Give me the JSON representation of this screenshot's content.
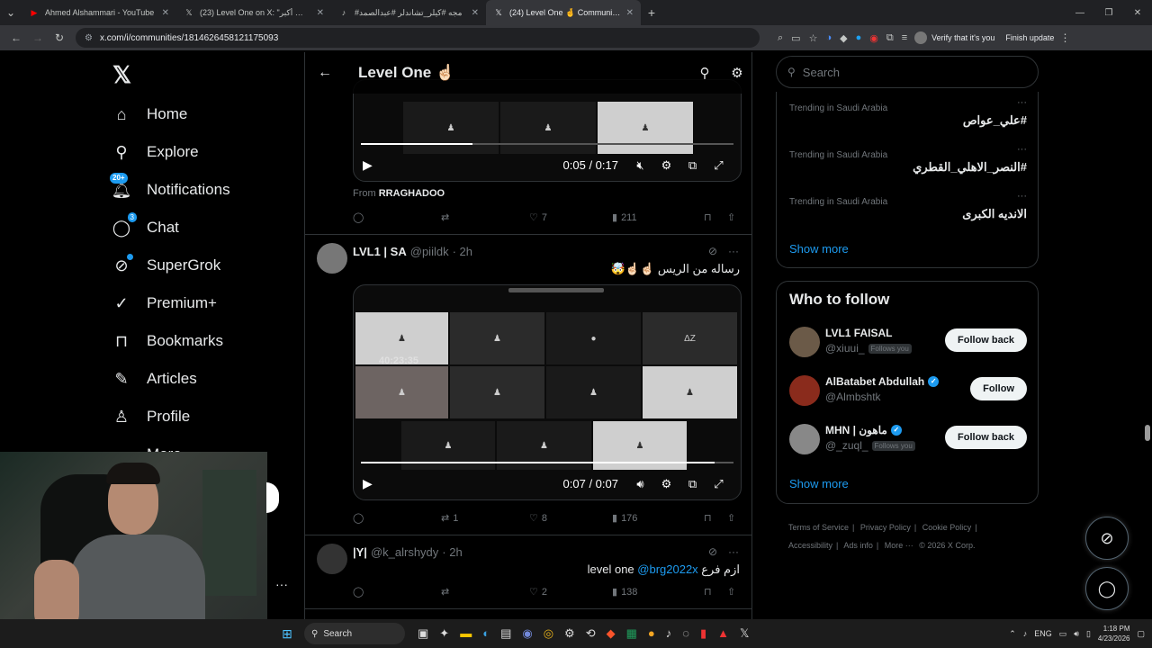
{
  "browser": {
    "tabs": [
      {
        "title": "Ahmed Alshammari - YouTube",
        "icon": "youtube-icon"
      },
      {
        "title": "(23) Level One on X: \"الهدف أكبر\"",
        "icon": "x-logo-icon"
      },
      {
        "title": "#مجه #كيلر_تشاندلر #عبدالصمد",
        "icon": "tiktok-icon"
      },
      {
        "title": "(24) Level One 🤞 Community / X",
        "icon": "x-logo-icon"
      }
    ],
    "url": "x.com/i/communities/1814626458121175093",
    "verify_label": "Verify that it's you",
    "finish_update_label": "Finish update"
  },
  "nav": {
    "items": [
      {
        "label": "Home",
        "icon": "home-icon"
      },
      {
        "label": "Explore",
        "icon": "search-icon"
      },
      {
        "label": "Notifications",
        "icon": "bell-icon",
        "badge": "20+"
      },
      {
        "label": "Chat",
        "icon": "chat-icon",
        "badge": "3"
      },
      {
        "label": "SuperGrok",
        "icon": "grok-icon"
      },
      {
        "label": "Premium+",
        "icon": "premium-icon"
      },
      {
        "label": "Bookmarks",
        "icon": "bookmark-icon"
      },
      {
        "label": "Articles",
        "icon": "article-icon"
      },
      {
        "label": "Profile",
        "icon": "person-icon"
      },
      {
        "label": "More",
        "icon": "more-circle-icon"
      }
    ]
  },
  "feed": {
    "title": "Level One ☝🏻",
    "post1": {
      "time": "0:05 / 0:17",
      "from_prefix": "From",
      "from_name": "RRAGHADOO",
      "replies": "",
      "reposts": "",
      "likes": "7",
      "views": "211"
    },
    "post2": {
      "name": "LVL1 | SA",
      "handle": "@piildk",
      "age": "· 2h",
      "text": "رساله من الريس ☝🏻☝🏻🤯",
      "time": "0:07 / 0:07",
      "timer_overlay": "40:23:35",
      "replies": "",
      "reposts": "1",
      "likes": "8",
      "views": "176"
    },
    "post3": {
      "name": "|Y|",
      "handle": "@k_alrshydy",
      "age": "· 2h",
      "text_prefix": "ازم فرع level one",
      "mention": "@brg2022x",
      "replies": "",
      "reposts": "",
      "likes": "2",
      "views": "138"
    }
  },
  "sidebar": {
    "search_placeholder": "Search",
    "trends": [
      {
        "label": "Trending in Saudi Arabia",
        "tag": "#علي_عواص"
      },
      {
        "label": "Trending in Saudi Arabia",
        "tag": "#النصر_الاهلي_القطري"
      },
      {
        "label": "Trending in Saudi Arabia",
        "tag": "الانديه الكبرى"
      }
    ],
    "show_more": "Show more",
    "who_to_follow_title": "Who to follow",
    "follow": [
      {
        "name": "LVL1 FAISAL",
        "handle": "@xiuui_",
        "follows_you": "Follows you",
        "button": "Follow back",
        "verified": false
      },
      {
        "name": "AlBatabet Abdullah",
        "handle": "@Almbshtk",
        "follows_you": "",
        "button": "Follow",
        "verified": true
      },
      {
        "name": "MHN | ماهون",
        "handle": "@_zuql_",
        "follows_you": "Follows you",
        "button": "Follow back",
        "verified": true
      }
    ],
    "show_more2": "Show more",
    "footer": [
      "Terms of Service",
      "|",
      "Privacy Policy",
      "|",
      "Cookie Policy",
      "|",
      "Accessibility",
      "|",
      "Ads info",
      "|",
      "More ···",
      "© 2026 X Corp."
    ]
  },
  "taskbar": {
    "search_label": "Search",
    "lang": "ENG",
    "time": "1:18 PM",
    "date": "4/23/2026"
  },
  "colors": {
    "accent": "#1d9bf0",
    "background": "#000000",
    "border": "#2f3336",
    "muted": "#71767b"
  }
}
